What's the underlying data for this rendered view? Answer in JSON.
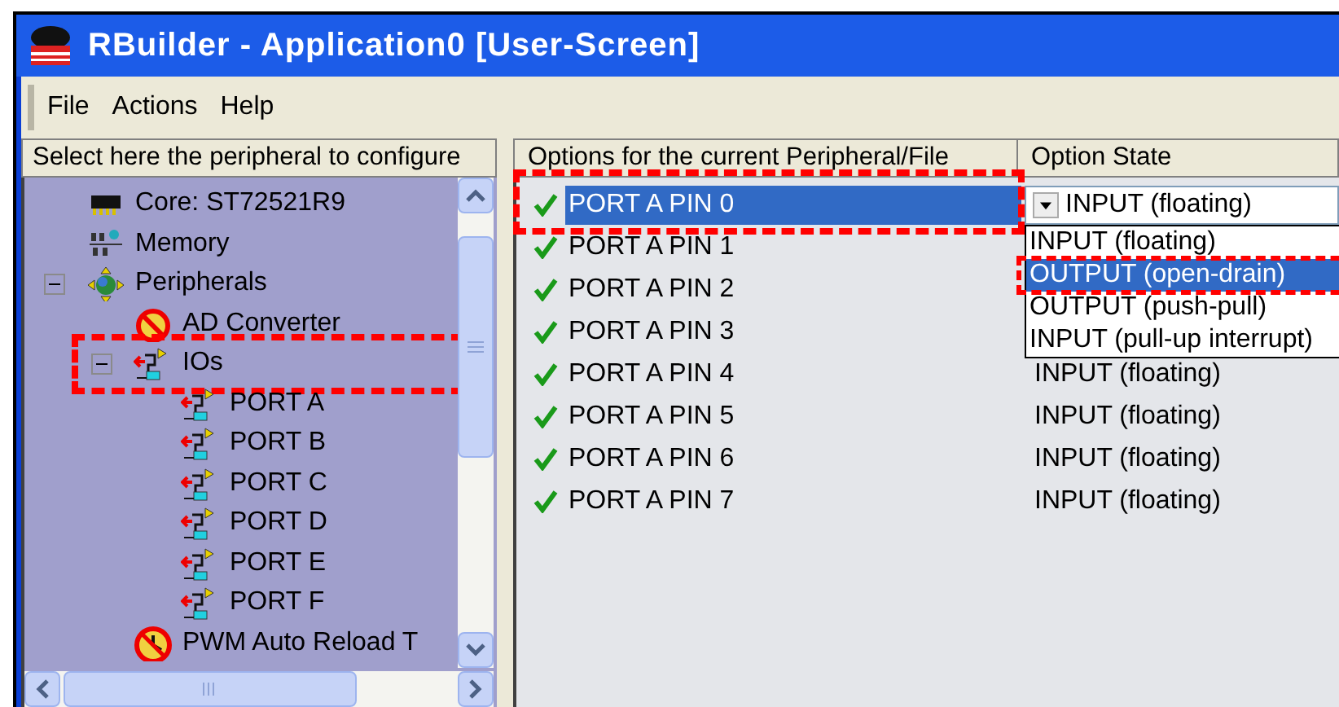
{
  "window": {
    "title": "RBuilder - Application0 [User-Screen]"
  },
  "menu": [
    "File",
    "Actions",
    "Help"
  ],
  "tree": {
    "header": "Select here the peripheral to configure",
    "items": [
      {
        "label": "Core: ST72521R9",
        "kind": "chip",
        "highlighted": false
      },
      {
        "label": "Memory",
        "kind": "memory",
        "highlighted": false
      },
      {
        "label": "Peripherals",
        "kind": "peripherals",
        "expanded": true,
        "highlighted": false,
        "children": [
          {
            "label": "AD Converter",
            "kind": "disabled",
            "highlighted": false
          },
          {
            "label": "IOs",
            "kind": "io",
            "expanded": true,
            "highlighted": true,
            "children": [
              {
                "label": "PORT A",
                "kind": "io",
                "highlighted": false
              },
              {
                "label": "PORT B",
                "kind": "io",
                "highlighted": false
              },
              {
                "label": "PORT C",
                "kind": "io",
                "highlighted": false
              },
              {
                "label": "PORT D",
                "kind": "io",
                "highlighted": false
              },
              {
                "label": "PORT E",
                "kind": "io",
                "highlighted": false
              },
              {
                "label": "PORT F",
                "kind": "io",
                "highlighted": false
              }
            ]
          },
          {
            "label": "PWM Auto Reload T",
            "kind": "timer",
            "highlighted": false
          }
        ]
      }
    ]
  },
  "options": {
    "columns": [
      "Options for the current Peripheral/File",
      "Option State"
    ],
    "rows": [
      {
        "name": "PORT A PIN 0",
        "state": "INPUT (floating)",
        "selected": true,
        "highlighted": true
      },
      {
        "name": "PORT A PIN 1",
        "selected": false,
        "highlighted": false
      },
      {
        "name": "PORT A PIN 2",
        "selected": false,
        "highlighted": false
      },
      {
        "name": "PORT A PIN 3",
        "selected": false,
        "highlighted": false
      },
      {
        "name": "PORT A PIN 4",
        "state": "INPUT (floating)",
        "selected": false,
        "highlighted": false
      },
      {
        "name": "PORT A PIN 5",
        "state": "INPUT (floating)",
        "selected": false,
        "highlighted": false
      },
      {
        "name": "PORT A PIN 6",
        "state": "INPUT (floating)",
        "selected": false,
        "highlighted": false
      },
      {
        "name": "PORT A PIN 7",
        "state": "INPUT (floating)",
        "selected": false,
        "highlighted": false
      }
    ],
    "dropdown": [
      {
        "label": "INPUT (floating)",
        "selected": false,
        "highlighted": false
      },
      {
        "label": "OUTPUT (open-drain)",
        "selected": true,
        "highlighted": true
      },
      {
        "label": "OUTPUT (push-pull)",
        "selected": false,
        "highlighted": false
      },
      {
        "label": "INPUT (pull-up interrupt)",
        "selected": false,
        "highlighted": false
      }
    ]
  }
}
